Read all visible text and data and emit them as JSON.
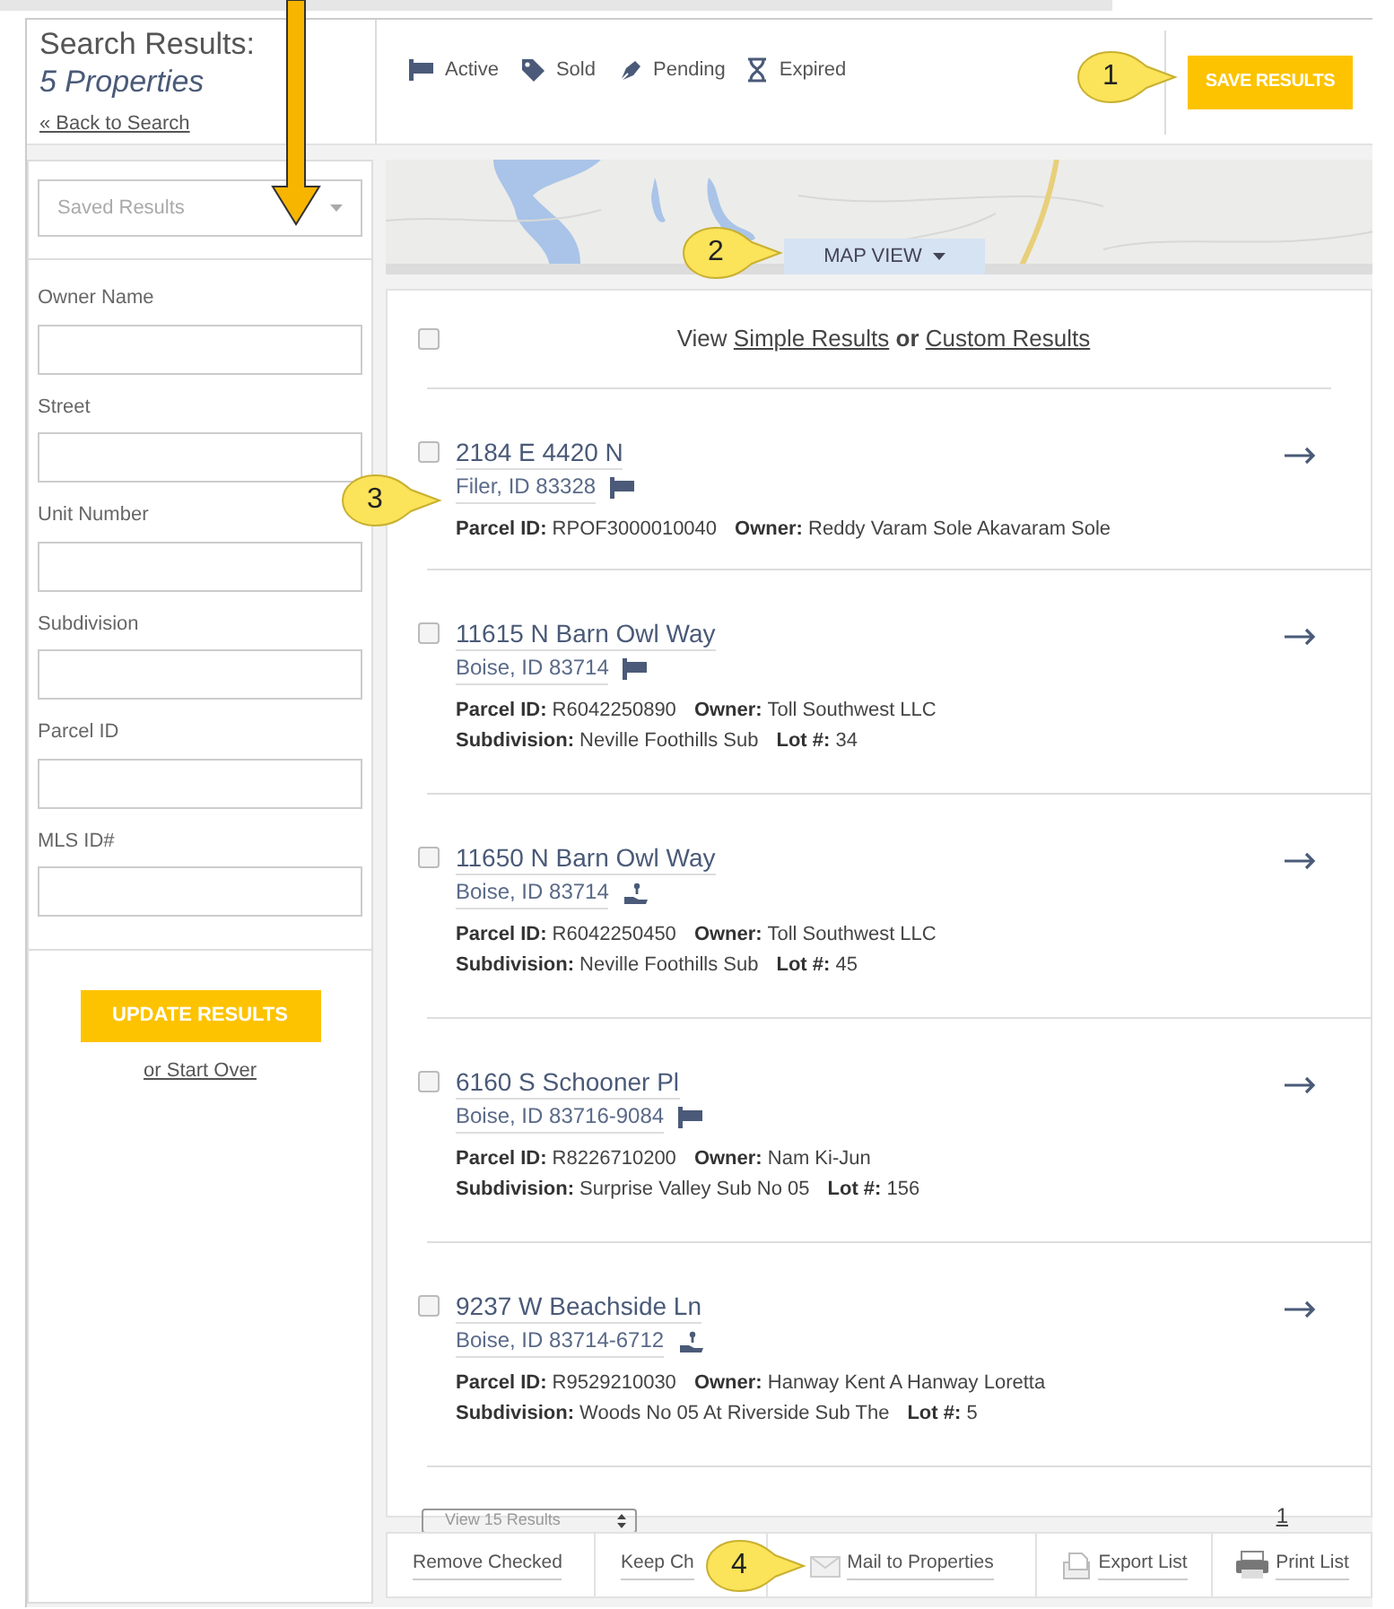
{
  "header": {
    "title": "Search Results:",
    "subtitle": "5 Properties",
    "back_link": "« Back to Search"
  },
  "legend": [
    {
      "kind": "active",
      "label": "Active"
    },
    {
      "kind": "sold",
      "label": "Sold"
    },
    {
      "kind": "pending",
      "label": "Pending"
    },
    {
      "kind": "expired",
      "label": "Expired"
    }
  ],
  "save_button": "SAVE RESULTS",
  "sidebar": {
    "saved_results": {
      "placeholder": "Saved Results"
    },
    "fields": [
      {
        "label": "Owner Name"
      },
      {
        "label": "Street"
      },
      {
        "label": "Unit Number"
      },
      {
        "label": "Subdivision"
      },
      {
        "label": "Parcel ID"
      },
      {
        "label": "MLS ID#"
      }
    ],
    "update_button": "UPDATE RESULTS",
    "start_over_link": "or Start Over"
  },
  "map": {
    "button": "MAP VIEW"
  },
  "results": {
    "select_all": {
      "checked": false
    },
    "view_prefix": "View",
    "simple_link": "Simple Results",
    "joiner": "or",
    "custom_link": "Custom Results",
    "items": [
      {
        "checked": false,
        "address": "2184 E 4420 N",
        "city": "Filer, ID 83328",
        "kind": "active",
        "lines": [
          [
            {
              "label": "Parcel ID:",
              "value": "RPOF3000010040"
            },
            {
              "label": "Owner:",
              "value": "Reddy Varam Sole Akavaram Sole"
            }
          ]
        ]
      },
      {
        "checked": false,
        "address": "11615 N Barn Owl Way",
        "city": "Boise, ID 83714",
        "kind": "active",
        "lines": [
          [
            {
              "label": "Parcel ID:",
              "value": "R6042250890"
            },
            {
              "label": "Owner:",
              "value": "Toll Southwest LLC"
            }
          ],
          [
            {
              "label": "Subdivision:",
              "value": "Neville Foothills Sub"
            },
            {
              "label": "Lot #:",
              "value": "34"
            }
          ]
        ]
      },
      {
        "checked": false,
        "address": "11650 N Barn Owl Way",
        "city": "Boise, ID 83714",
        "kind": "pending",
        "lines": [
          [
            {
              "label": "Parcel ID:",
              "value": "R6042250450"
            },
            {
              "label": "Owner:",
              "value": "Toll Southwest LLC"
            }
          ],
          [
            {
              "label": "Subdivision:",
              "value": "Neville Foothills Sub"
            },
            {
              "label": "Lot #:",
              "value": "45"
            }
          ]
        ]
      },
      {
        "checked": false,
        "address": "6160 S Schooner Pl",
        "city": "Boise, ID 83716-9084",
        "kind": "active",
        "lines": [
          [
            {
              "label": "Parcel ID:",
              "value": "R8226710200"
            },
            {
              "label": "Owner:",
              "value": "Nam Ki-Jun"
            }
          ],
          [
            {
              "label": "Subdivision:",
              "value": "Surprise Valley Sub No 05"
            },
            {
              "label": "Lot #:",
              "value": "156"
            }
          ]
        ]
      },
      {
        "checked": false,
        "address": "9237 W Beachside Ln",
        "city": "Boise, ID 83714-6712",
        "kind": "pending",
        "lines": [
          [
            {
              "label": "Parcel ID:",
              "value": "R9529210030"
            },
            {
              "label": "Owner:",
              "value": "Hanway Kent A Hanway Loretta"
            }
          ],
          [
            {
              "label": "Subdivision:",
              "value": "Woods No 05 At Riverside Sub The"
            },
            {
              "label": "Lot #:",
              "value": "5"
            }
          ]
        ]
      }
    ],
    "page_size": "View 15 Results",
    "page": "1"
  },
  "toolbar": [
    {
      "kind": "text",
      "label": "Remove Checked"
    },
    {
      "kind": "text",
      "label": "Keep Ch"
    },
    {
      "kind": "mail",
      "label": "Mail to Properties"
    },
    {
      "kind": "export",
      "label": "Export List"
    },
    {
      "kind": "print",
      "label": "Print List"
    }
  ],
  "callouts": [
    {
      "number": "1"
    },
    {
      "number": "2"
    },
    {
      "number": "3"
    },
    {
      "number": "4"
    }
  ]
}
